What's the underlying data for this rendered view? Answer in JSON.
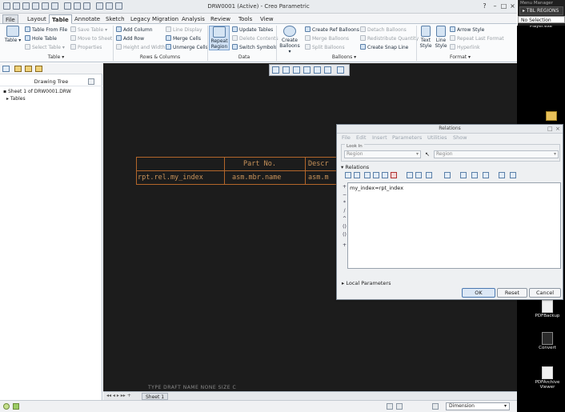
{
  "window": {
    "title": "DRW0001 (Active) - Creo Parametric"
  },
  "tabs": [
    {
      "label": "File"
    },
    {
      "label": "Layout"
    },
    {
      "label": "Table"
    },
    {
      "label": "Annotate"
    },
    {
      "label": "Sketch"
    },
    {
      "label": "Legacy Migration"
    },
    {
      "label": "Analysis"
    },
    {
      "label": "Review"
    },
    {
      "label": "Tools"
    },
    {
      "label": "View"
    }
  ],
  "ribbon": {
    "table_group": {
      "table_label": "Table",
      "table_from_file": "Table From File",
      "hole_table": "Hole Table",
      "select_table": "Select Table",
      "save_table": "Save Table",
      "move_to_sheet": "Move to Sheet",
      "properties": "Properties",
      "group_label": "Table"
    },
    "rows_columns": {
      "add_column": "Add Column",
      "add_row": "Add Row",
      "height_width": "Height and Width",
      "line_display": "Line Display",
      "merge_cells": "Merge Cells",
      "unmerge_cells": "Unmerge Cells",
      "group_label": "Rows & Columns"
    },
    "data": {
      "repeat_region_line1": "Repeat",
      "repeat_region_line2": "Region",
      "update_tables": "Update Tables",
      "delete_contents": "Delete Contents",
      "switch_symbols": "Switch Symbols",
      "group_label": "Data"
    },
    "balloons": {
      "create_balloons_line1": "Create",
      "create_balloons_line2": "Balloons",
      "create_ref_balloons": "Create Ref Balloons",
      "merge_balloons": "Merge Balloons",
      "split_balloons": "Split Balloons",
      "detach_balloons": "Detach Balloons",
      "redistribute_quantity": "Redistribute Quantity",
      "create_snap_line": "Create Snap Line",
      "group_label": "Balloons"
    },
    "format": {
      "text_style_line1": "Text",
      "text_style_line2": "Style",
      "line_style_line1": "Line",
      "line_style_line2": "Style",
      "arrow_style": "Arrow Style",
      "repeat_last_format": "Repeat Last Format",
      "hyperlink": "Hyperlink",
      "group_label": "Format"
    }
  },
  "left_panel": {
    "header": "Drawing Tree",
    "items": [
      {
        "label": "Sheet 1 of DRW0001.DRW"
      },
      {
        "label": "Tables"
      }
    ]
  },
  "drawing_table": {
    "header_cells": [
      "Part No.",
      "Descr"
    ],
    "data_cells": [
      "rpt.rel.my_index",
      "asm.mbr.name",
      "asm.m"
    ]
  },
  "format_line": "TYPE  DRAFT   NAME  NONE   SIZE  C",
  "sheet_tab": "Sheet 1",
  "status": {
    "dimension_filter": "Dimension"
  },
  "menu_manager": {
    "title": "Menu Manager",
    "item": "TBL REGIONS",
    "no_selection": "No Selection"
  },
  "desktop": {
    "icons": [
      {
        "label": "Player.exe"
      },
      {
        "label": "PDFBackup"
      },
      {
        "label": "Convert"
      },
      {
        "label": "PDFArchive Viewer"
      }
    ]
  },
  "relations_dialog": {
    "title": "Relations",
    "menu": [
      "File",
      "Edit",
      "Insert",
      "Parameters",
      "Utilities",
      "Show"
    ],
    "look_in_label": "Look In",
    "look_in_value": "Region",
    "look_in_type": "Region",
    "relations_header": "Relations",
    "relation_text": "my_index=rpt_index",
    "local_parameters": "Local Parameters",
    "ok": "OK",
    "reset": "Reset",
    "cancel": "Cancel"
  }
}
